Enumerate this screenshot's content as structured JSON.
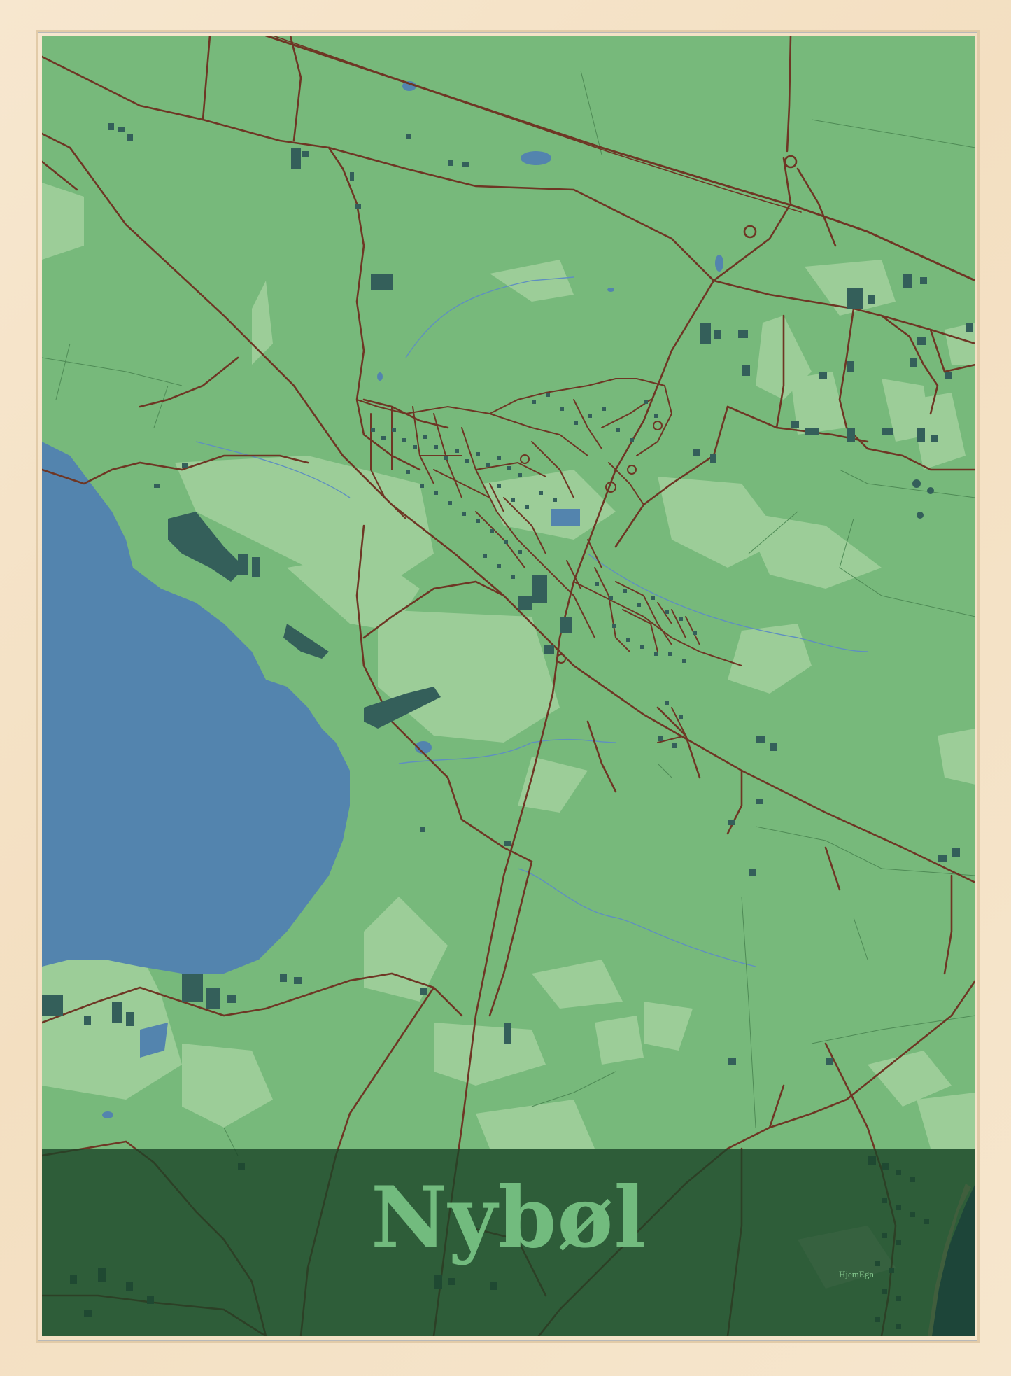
{
  "poster": {
    "title": "Nybøl",
    "brand": "HjemEgn"
  },
  "colors": {
    "land": "#77b97b",
    "land_light": "#9ccd98",
    "water": "#5384ae",
    "water_dark": "#2b4e7a",
    "roads": "#6e3624",
    "buildings": "#345f5a",
    "band": "#1a4226",
    "frame": "#f5e4c9"
  },
  "icons": [
    "map-water-lake",
    "map-roads",
    "map-buildings"
  ]
}
